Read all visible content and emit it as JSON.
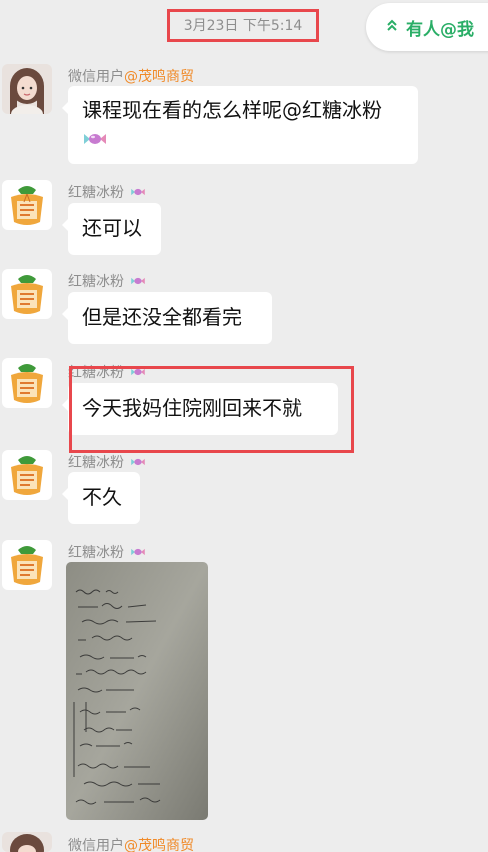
{
  "timestamp": "3月23日 下午5:14",
  "mention": {
    "label": "有人@我",
    "color": "#2aae67"
  },
  "messages": [
    {
      "sender": "微信用户",
      "sender_tag": "@茂鸣商贸",
      "text": "课程现在看的怎么样呢@红糖冰粉",
      "text_line2": ""
    },
    {
      "sender": "红糖冰粉",
      "text": "还可以"
    },
    {
      "sender": "红糖冰粉",
      "text": "但是还没全都看完"
    },
    {
      "sender": "红糖冰粉",
      "text": "今天我妈住院刚回来不就"
    },
    {
      "sender": "红糖冰粉",
      "text": "不久"
    },
    {
      "sender": "红糖冰粉",
      "text": ""
    },
    {
      "sender": "微信用户",
      "sender_tag": "@茂鸣商贸"
    }
  ],
  "colors": {
    "background": "#ededed",
    "bubble": "#ffffff",
    "highlight": "#e8474c",
    "sender_tag": "#f08a28"
  }
}
